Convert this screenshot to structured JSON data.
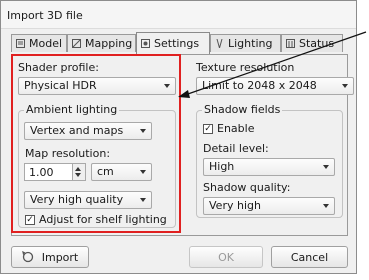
{
  "window": {
    "title": "Import 3D file"
  },
  "tabs": [
    {
      "label": "Model",
      "icon": "model-icon"
    },
    {
      "label": "Mapping",
      "icon": "mapping-icon"
    },
    {
      "label": "Settings",
      "icon": "settings-icon",
      "active": true
    },
    {
      "label": "Lighting",
      "icon": "lighting-icon"
    },
    {
      "label": "Status",
      "icon": "status-icon"
    }
  ],
  "settings": {
    "shader_profile": {
      "label": "Shader profile:",
      "value": "Physical HDR"
    },
    "ambient_lighting": {
      "title": "Ambient lighting",
      "mode": "Vertex and maps",
      "map_resolution_label": "Map resolution:",
      "map_resolution_value": "1.00",
      "unit": "cm",
      "quality": "Very high quality",
      "adjust_label": "Adjust for shelf lighting",
      "adjust_checked": true
    },
    "texture_resolution": {
      "label": "Texture resolution",
      "value": "Limit to 2048 x 2048"
    },
    "shadow_fields": {
      "title": "Shadow fields",
      "enable_label": "Enable",
      "enable_checked": true,
      "detail_label": "Detail level:",
      "detail_value": "High",
      "quality_label": "Shadow quality:",
      "quality_value": "Very high"
    }
  },
  "buttons": {
    "import": "Import",
    "ok": "OK",
    "cancel": "Cancel"
  },
  "colors": {
    "highlight": "#e02020"
  }
}
